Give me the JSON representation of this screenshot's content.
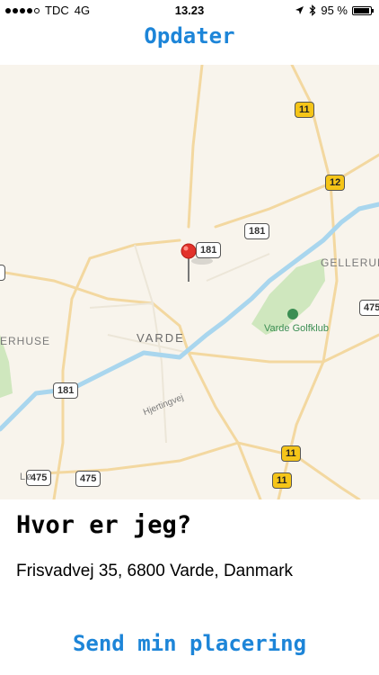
{
  "status_bar": {
    "carrier": "TDC",
    "network": "4G",
    "time": "13.23",
    "battery": "95 %",
    "battery_level": 0.95
  },
  "header": {
    "update_label": "Opdater"
  },
  "map": {
    "town_label": "VARDE",
    "area_label": "GELLERUP",
    "area_label_left": "ERHUSE",
    "golf_label": "Varde Golfklub",
    "street_label": "Hjertingvej",
    "cut_label": "Lø",
    "shields": {
      "s11_top": "11",
      "s12": "12",
      "s181_pin": "181",
      "s181_right": "181",
      "s181_bottom": "181",
      "s475_right": "475",
      "s475_a": "475",
      "s475_b": "475",
      "s11_lower": "11",
      "s11_lowest": "11"
    },
    "colors": {
      "land": "#f8f4ec",
      "water": "#a9d6ee",
      "park": "#cfe7be",
      "road": "#f3d8a0",
      "pin": "#e2322b"
    }
  },
  "location": {
    "title": "Hvor er jeg?",
    "address": "Frisvadvej 35, 6800 Varde, Danmark"
  },
  "footer": {
    "send_label": "Send min placering"
  },
  "accent_color": "#1d85d8"
}
